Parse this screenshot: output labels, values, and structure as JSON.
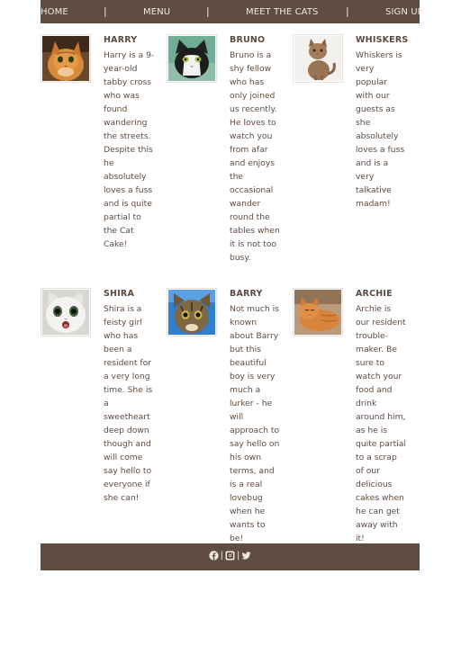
{
  "nav": {
    "home": "HOME",
    "menu": "MENU",
    "meet": "MEET THE CATS",
    "signup": "SIGN UP",
    "separator": "|"
  },
  "cats": [
    {
      "name": "HARRY",
      "image": "orange-tabby-cat-photo",
      "description": "Harry is a 9-year-old tabby cross who was found wandering the streets. Despite this he absolutely loves a fuss and is quite partial to the Cat Cake!"
    },
    {
      "name": "BRUNO",
      "image": "black-white-cat-photo",
      "description": "Bruno is a shy fellow who has only joined us recently. He loves to watch you from afar and enjoys the occasional wander round the tables when it is not too busy."
    },
    {
      "name": "WHISKERS",
      "image": "brown-tabby-sitting-cat-photo",
      "description": "Whiskers is very popular with our guests as she absolutely loves a fuss and is a very talkative madam!"
    },
    {
      "name": "SHIRA",
      "image": "white-kitten-surprised-photo",
      "description": "Shira is a feisty girl who has been a resident for a very long time. She is a sweetheart deep down though and will come say hello to everyone if she can!"
    },
    {
      "name": "BARRY",
      "image": "tabby-cat-blue-background-photo",
      "description": "Not much is known about Barry but this beautiful boy is very much a lurker - he will approach to say hello on his own terms, and is a real lovebug when he wants to be!"
    },
    {
      "name": "ARCHIE",
      "image": "ginger-cat-lying-photo",
      "description": "Archie is our resident trouble-maker. Be sure to watch your food and drink around him, as he is quite partial to a scrap of our delicious cakes when he can get away with it!"
    }
  ],
  "footer": {
    "icons": [
      "facebook-icon",
      "instagram-icon",
      "twitter-icon"
    ],
    "separator": "|"
  },
  "colors": {
    "bar": "#5f4d41",
    "nav_text": "#efe7e1",
    "body_text": "#5f4c40"
  }
}
